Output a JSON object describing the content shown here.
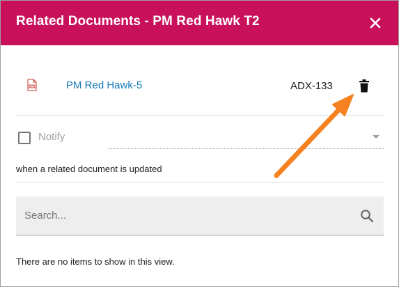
{
  "dialog": {
    "title": "Related Documents - PM Red Hawk T2",
    "close_icon": "close-icon",
    "header_color": "#c8115a"
  },
  "document": {
    "icon": "document-icon",
    "name": "PM Red Hawk-5",
    "code": "ADX-133",
    "delete_icon": "trash-icon",
    "link_color": "#1479b8"
  },
  "notify": {
    "label": "Notify",
    "checked": false,
    "help_text": "when a related document is updated"
  },
  "search": {
    "placeholder": "Search...",
    "icon": "search-icon"
  },
  "list": {
    "empty_message": "There are no items to show in this view."
  },
  "annotation": {
    "color": "#f5821f"
  }
}
